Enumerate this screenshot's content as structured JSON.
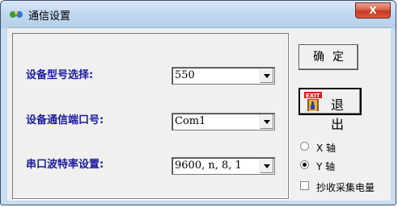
{
  "window": {
    "title": "通信设置",
    "close_label": "X"
  },
  "form": {
    "model_label": "设备型号选择:",
    "model_value": "550",
    "port_label": "设备通信端口号:",
    "port_value": "Com1",
    "baud_label": "串口波特率设置:",
    "baud_value": "9600, n, 8, 1"
  },
  "buttons": {
    "ok_label": "确定",
    "exit_label": "退出",
    "exit_icon_text": "EXIT"
  },
  "axis": {
    "x_label": "X 轴",
    "y_label": "Y 轴",
    "selected": "Y"
  },
  "collect": {
    "label": "抄收采集电量",
    "checked": false
  },
  "colors": {
    "label_blue": "#1a1aa0",
    "exit_red": "#d42020"
  }
}
